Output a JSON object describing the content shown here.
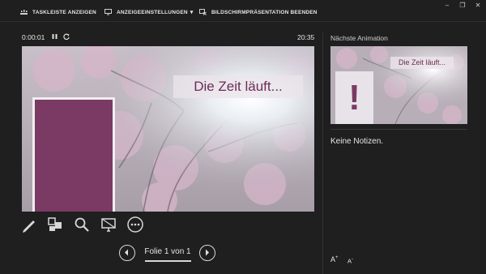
{
  "toolbar": {
    "taskbar_label": "TASKLEISTE ANZEIGEN",
    "display_label": "ANZEIGEEINSTELLUNGEN",
    "display_caret": "▾",
    "end_label": "BILDSCHIRMPRÄSENTATION BEENDEN",
    "minimize": "–",
    "restore": "❐",
    "close": "✕"
  },
  "timer": {
    "elapsed": "0:00:01",
    "clock": "20:35"
  },
  "slide": {
    "title": "Die Zeit läuft..."
  },
  "tools": [
    "pen-icon",
    "slides-grid-icon",
    "zoom-icon",
    "screen-icon",
    "more-icon"
  ],
  "navigation": {
    "label": "Folie 1 von 1"
  },
  "panel": {
    "next_label": "Nächste Animation",
    "thumb_title": "Die Zeit läuft...",
    "thumb_symbol": "!",
    "notes": "Keine Notizen.",
    "font_larger": "A",
    "font_smaller": "A"
  },
  "colors": {
    "accent": "#7b3a63",
    "background": "#1f1f1f",
    "title_text": "#6b2d55"
  }
}
